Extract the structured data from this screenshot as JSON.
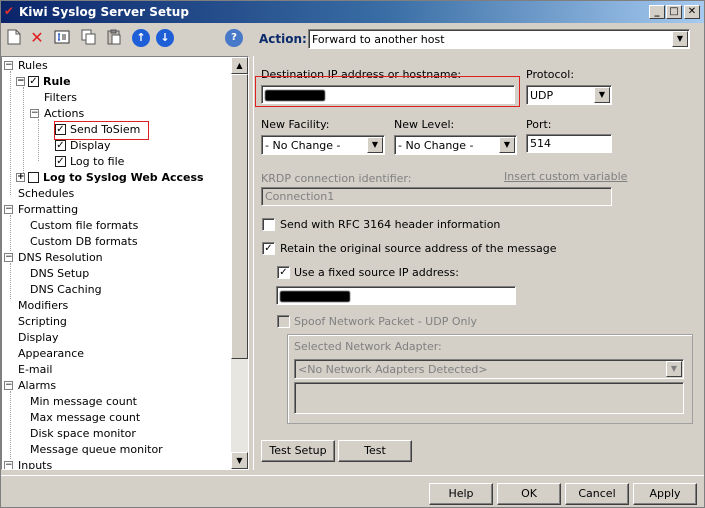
{
  "window": {
    "title": "Kiwi Syslog Server Setup",
    "controls": [
      "_",
      "□",
      "✕"
    ]
  },
  "toolbar": {
    "icons": [
      "new-icon",
      "delete-icon",
      "rename-icon",
      "copy-icon",
      "paste-icon",
      "move-up-icon",
      "move-down-icon",
      "help-icon"
    ],
    "action_label": "Action:",
    "action_value": "Forward to another host"
  },
  "tree": {
    "items": [
      {
        "label": "Rules"
      },
      {
        "label": "Rule"
      },
      {
        "label": "Filters"
      },
      {
        "label": "Actions"
      },
      {
        "label": "Send ToSiem"
      },
      {
        "label": "Display"
      },
      {
        "label": "Log to file"
      },
      {
        "label": "Log to Syslog Web Access"
      },
      {
        "label": "Schedules"
      },
      {
        "label": "Formatting"
      },
      {
        "label": "Custom file formats"
      },
      {
        "label": "Custom DB formats"
      },
      {
        "label": "DNS Resolution"
      },
      {
        "label": "DNS Setup"
      },
      {
        "label": "DNS Caching"
      },
      {
        "label": "Modifiers"
      },
      {
        "label": "Scripting"
      },
      {
        "label": "Display"
      },
      {
        "label": "Appearance"
      },
      {
        "label": "E-mail"
      },
      {
        "label": "Alarms"
      },
      {
        "label": "Min message count"
      },
      {
        "label": "Max message count"
      },
      {
        "label": "Disk space monitor"
      },
      {
        "label": "Message queue monitor"
      },
      {
        "label": "Inputs"
      }
    ]
  },
  "form": {
    "dest_label": "Destination IP address or hostname:",
    "protocol_label": "Protocol:",
    "protocol_value": "UDP",
    "facility_label": "New Facility:",
    "facility_value": "- No Change -",
    "level_label": "New Level:",
    "level_value": "- No Change -",
    "port_label": "Port:",
    "port_value": "514",
    "krdp_label": "KRDP connection identifier:",
    "krdp_link": "Insert custom variable",
    "krdp_value": "Connection1",
    "rfc_label": "Send with RFC 3164 header information",
    "retain_label": "Retain the original source address of the message",
    "fixed_label": "Use a fixed source IP address:",
    "spoof_label": "Spoof Network Packet - UDP Only",
    "adapter_label": "Selected Network Adapter:",
    "adapter_value": "<No Network Adapters Detected>",
    "test_setup": "Test Setup",
    "test": "Test"
  },
  "footer": {
    "help": "Help",
    "ok": "OK",
    "cancel": "Cancel",
    "apply": "Apply"
  },
  "colors": {
    "title_start": "#0a246a",
    "title_end": "#a6caf0",
    "highlight_box": "#e02020",
    "action_label": "#0a2a6a"
  }
}
